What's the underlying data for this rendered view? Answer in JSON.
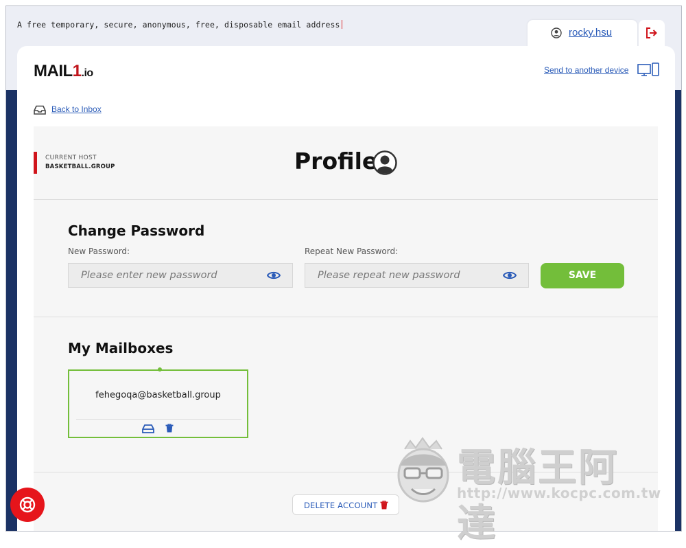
{
  "header": {
    "tagline": "A free temporary, secure, anonymous, free, disposable email address",
    "username": "rocky.hsu"
  },
  "card": {
    "logo_main": "MAIL",
    "logo_one": "1",
    "logo_io": ".io",
    "send_link": "Send to another device",
    "back_link": "Back to Inbox"
  },
  "host": {
    "title": "CURRENT HOST",
    "value": "BASKETBALL.GROUP"
  },
  "profile": {
    "title": "Profile"
  },
  "change_password": {
    "title": "Change Password",
    "new_label": "New Password:",
    "new_placeholder": "Please enter new password",
    "repeat_label": "Repeat New Password:",
    "repeat_placeholder": "Please repeat new password",
    "save_label": "SAVE"
  },
  "mailboxes": {
    "title": "My Mailboxes",
    "items": [
      {
        "address": "fehegoqa@basketball.group"
      }
    ]
  },
  "delete_account_label": "DELETE ACCOUNT",
  "watermark": {
    "brand": "電腦王阿達",
    "url": "http://www.kocpc.com.tw"
  },
  "colors": {
    "accent_blue": "#2a5bb8",
    "brand_red": "#c0141b",
    "save_green": "#73be3a",
    "outer_navy": "#1b3264"
  },
  "icons": [
    "user-circle-icon",
    "logout-icon",
    "devices-icon",
    "inbox-icon",
    "eye-icon",
    "trash-icon",
    "lifebuoy-icon"
  ]
}
